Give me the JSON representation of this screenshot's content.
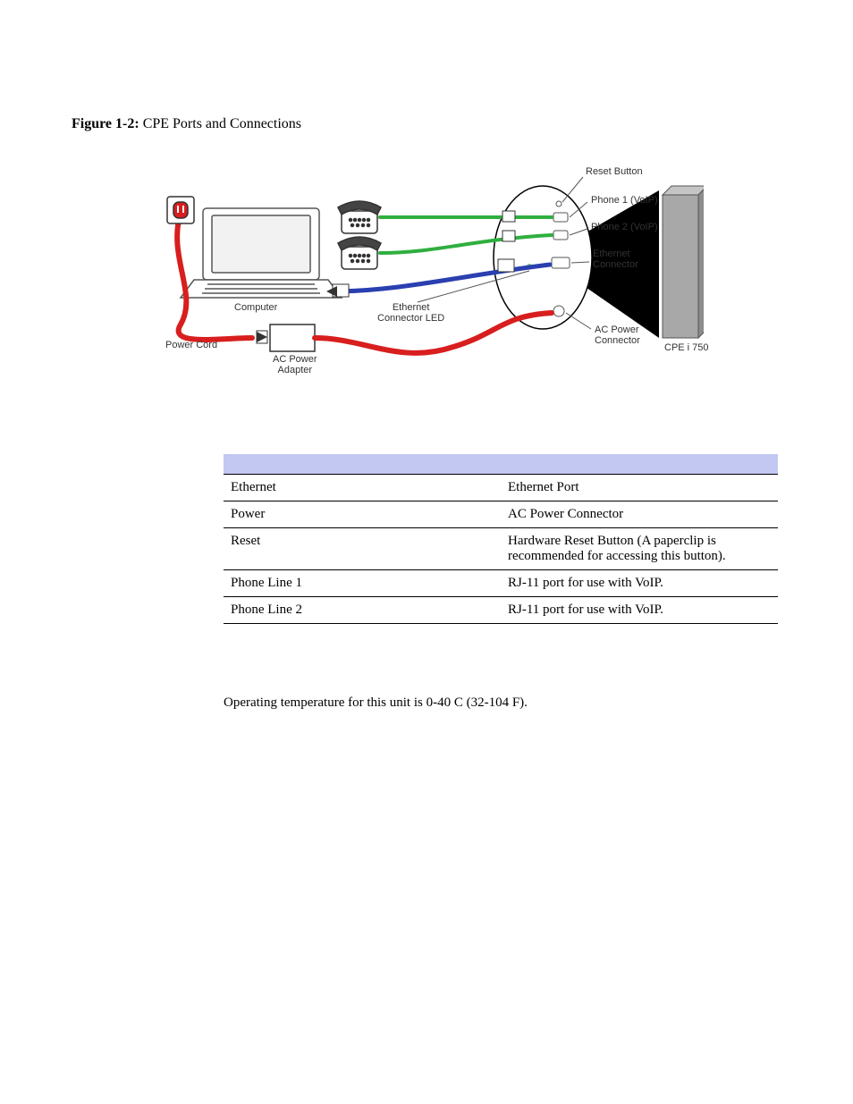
{
  "figure": {
    "label": "Figure 1-2:",
    "caption": "CPE Ports and Connections"
  },
  "diagram_labels": {
    "reset_button": "Reset Button",
    "phone1": "Phone 1 (VoIP)",
    "phone2": "Phone 2 (VoIP)",
    "ethernet_conn": "Ethernet\nConnector",
    "ac_power_conn": "AC Power\nConnector",
    "cpe_unit": "CPE i 750",
    "computer": "Computer",
    "ethernet_led": "Ethernet\nConnector LED",
    "ac_adapter": "AC Power\nAdapter",
    "power_cord": "Power Cord"
  },
  "table": {
    "rows": [
      {
        "name": "Ethernet",
        "desc": "Ethernet Port"
      },
      {
        "name": "Power",
        "desc": "AC Power Connector"
      },
      {
        "name": "Reset",
        "desc": "Hardware Reset Button (A paperclip is recommended for accessing this button)."
      },
      {
        "name": "Phone Line 1",
        "desc": "RJ-11 port for use with VoIP."
      },
      {
        "name": "Phone Line 2",
        "desc": "RJ-11 port for use with VoIP."
      }
    ]
  },
  "body_text": "Operating temperature for this unit is 0-40  C (32-104  F)."
}
